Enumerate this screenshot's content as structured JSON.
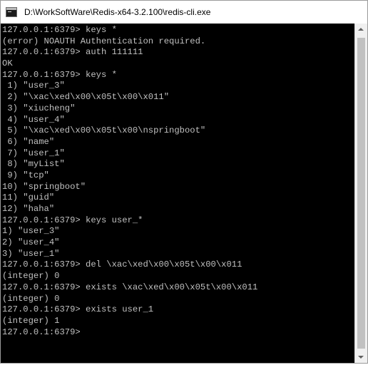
{
  "window": {
    "title": "D:\\WorkSoftWare\\Redis-x64-3.2.100\\redis-cli.exe",
    "icon": "console-app-icon"
  },
  "colors": {
    "console_bg": "#000000",
    "console_text": "#c0c0c0",
    "titlebar_bg": "#ffffff"
  },
  "console": {
    "lines": [
      "127.0.0.1:6379> keys *",
      "(error) NOAUTH Authentication required.",
      "127.0.0.1:6379> auth 111111",
      "OK",
      "127.0.0.1:6379> keys *",
      " 1) \"user_3\"",
      " 2) \"\\xac\\xed\\x00\\x05t\\x00\\x011\"",
      " 3) \"xiucheng\"",
      " 4) \"user_4\"",
      " 5) \"\\xac\\xed\\x00\\x05t\\x00\\nspringboot\"",
      " 6) \"name\"",
      " 7) \"user_1\"",
      " 8) \"myList\"",
      " 9) \"tcp\"",
      "10) \"springboot\"",
      "11) \"guid\"",
      "12) \"haha\"",
      "127.0.0.1:6379> keys user_*",
      "1) \"user_3\"",
      "2) \"user_4\"",
      "3) \"user_1\"",
      "127.0.0.1:6379> del \\xac\\xed\\x00\\x05t\\x00\\x011",
      "(integer) 0",
      "127.0.0.1:6379> exists \\xac\\xed\\x00\\x05t\\x00\\x011",
      "(integer) 0",
      "127.0.0.1:6379> exists user_1",
      "(integer) 1",
      "127.0.0.1:6379>"
    ]
  }
}
